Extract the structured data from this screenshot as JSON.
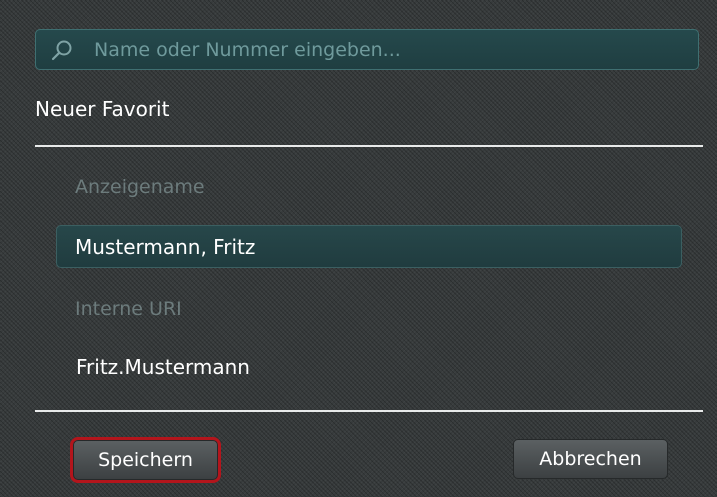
{
  "search": {
    "placeholder": "Name oder Nummer eingeben...",
    "value": ""
  },
  "form": {
    "title": "Neuer Favorit",
    "display_name": {
      "label": "Anzeigename",
      "value": "Mustermann, Fritz"
    },
    "internal_uri": {
      "label": "Interne URI",
      "value": "Fritz.Mustermann"
    }
  },
  "actions": {
    "save_label": "Speichern",
    "cancel_label": "Abbrechen"
  },
  "icons": {
    "search": "search-icon"
  },
  "colors": {
    "accent_highlight": "#b3151c",
    "input_background": "#25494c",
    "muted_label": "#6c7b7c"
  }
}
